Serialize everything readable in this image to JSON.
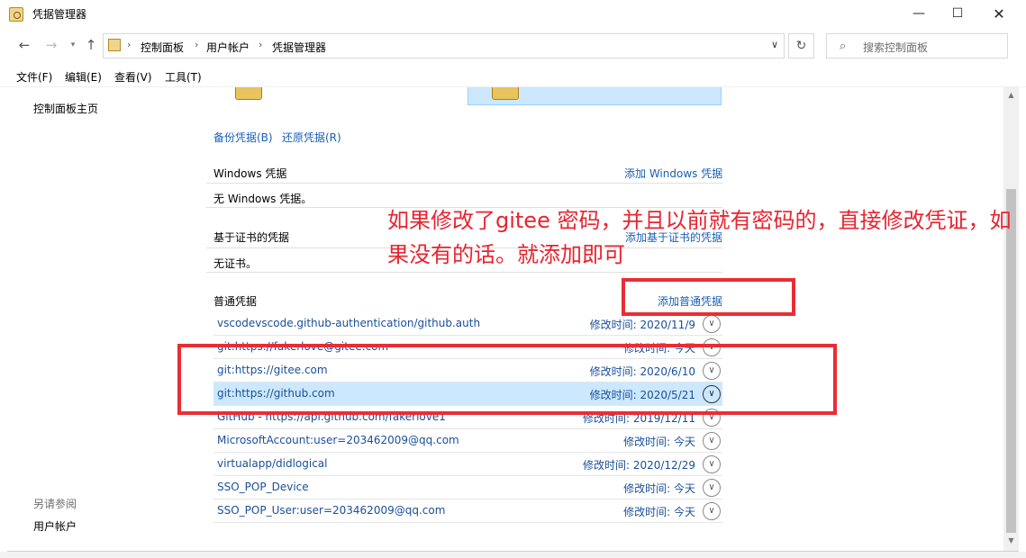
{
  "window": {
    "title": "凭据管理器"
  },
  "address": {
    "crumbs": [
      "控制面板",
      "用户帐户",
      "凭据管理器"
    ],
    "search_placeholder": "搜索控制面板"
  },
  "menu": [
    "文件(F)",
    "编辑(E)",
    "查看(V)",
    "工具(T)"
  ],
  "left_pane": {
    "home": "控制面板主页",
    "see_also": "另请参阅",
    "user_accounts": "用户帐户"
  },
  "actions": {
    "backup": "备份凭据(B)",
    "restore": "还原凭据(R)"
  },
  "windows_section": {
    "title": "Windows 凭据",
    "add": "添加 Windows 凭据",
    "empty": "无 Windows 凭据。"
  },
  "cert_section": {
    "title": "基于证书的凭据",
    "add": "添加基于证书的凭据",
    "empty": "无证书。"
  },
  "generic_section": {
    "title": "普通凭据",
    "add": "添加普通凭据",
    "items": [
      {
        "name": "vscodevscode.github-authentication/github.auth",
        "modified": "修改时间:  2020/11/9",
        "selected": false
      },
      {
        "name": "git:https://fakerlove@gitee.com",
        "modified": "修改时间:  今天",
        "selected": false
      },
      {
        "name": "git:https://gitee.com",
        "modified": "修改时间:  2020/6/10",
        "selected": false
      },
      {
        "name": "git:https://github.com",
        "modified": "修改时间:  2020/5/21",
        "selected": true
      },
      {
        "name": "GitHub - https://api.github.com/fakerlove1",
        "modified": "修改时间:  2019/12/11",
        "selected": false
      },
      {
        "name": "MicrosoftAccount:user=203462009@qq.com",
        "modified": "修改时间:  今天",
        "selected": false
      },
      {
        "name": "virtualapp/didlogical",
        "modified": "修改时间:  2020/12/29",
        "selected": false
      },
      {
        "name": "SSO_POP_Device",
        "modified": "修改时间:  今天",
        "selected": false
      },
      {
        "name": "SSO_POP_User:user=203462009@qq.com",
        "modified": "修改时间:  今天",
        "selected": false
      }
    ]
  },
  "annotation": {
    "text": "如果修改了gitee 密码，并且以前就有密码的，直接修改凭证，如果没有的话。就添加即可"
  },
  "colors": {
    "link": "#1a5fb4",
    "selected_row": "#cce8ff",
    "annotation_red": "#e8242f"
  },
  "icons": [
    "credential-manager-icon",
    "back-arrow-icon",
    "forward-arrow-icon",
    "recent-dropdown-icon",
    "up-arrow-icon",
    "refresh-icon",
    "search-icon",
    "chevron-down-icon",
    "minimize-icon",
    "maximize-icon",
    "close-icon",
    "vault-icon"
  ]
}
